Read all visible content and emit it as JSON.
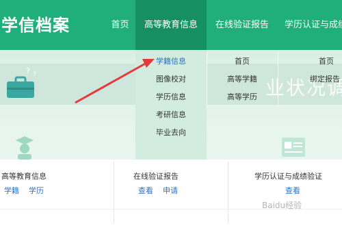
{
  "header": {
    "logo": "学信档案",
    "nav": [
      {
        "label": "首页",
        "active": false
      },
      {
        "label": "高等教育信息",
        "active": true
      },
      {
        "label": "在线验证报告",
        "active": false
      },
      {
        "label": "学历认证与成绩",
        "active": false
      }
    ]
  },
  "dropdown": {
    "items": [
      "学籍信息",
      "图像校对",
      "学历信息",
      "考研信息",
      "毕业去向"
    ],
    "highlighted": "学籍信息"
  },
  "col_verify": {
    "items": [
      "首页",
      "高等学籍",
      "高等学历"
    ]
  },
  "col_cert": {
    "items": [
      "首页",
      "绑定报告"
    ]
  },
  "banner": {
    "text": "业状况调"
  },
  "cards": [
    {
      "title": "高等教育信息",
      "links": [
        "学籍",
        "学历"
      ]
    },
    {
      "title": "在线验证报告",
      "links": [
        "查看",
        "申请"
      ]
    },
    {
      "title": "学历认证与成绩验证",
      "links": [
        "查看"
      ]
    }
  ],
  "watermark": "Baidu经验",
  "colors": {
    "brand": "#1fae7c",
    "nav_active": "#178f65",
    "link": "#2a72c8",
    "arrow": "#e63a3a"
  }
}
